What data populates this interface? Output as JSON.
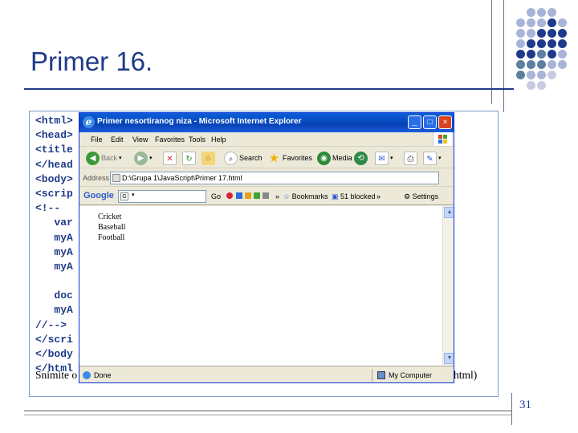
{
  "slide": {
    "title": "Primer  16.",
    "page_number": "31",
    "code_lines": [
      "<html>",
      "<head>",
      "<title",
      "</head",
      "<body>",
      "<scrip",
      "<!--",
      "   var",
      "   myA",
      "   myA",
      "   myA",
      "",
      "   doc",
      "   myA",
      "//-->",
      "</scri",
      "</body",
      "</html"
    ],
    "footer_text": "Snimite o",
    "footer_tail": "html)",
    "colors": {
      "title": "#1f3a8a",
      "code": "#1f3a8a",
      "frame": "#7a9cc6"
    }
  },
  "ie": {
    "title": "Primer nesortiranog niza - Microsoft Internet Explorer",
    "window_buttons": {
      "minimize": "_",
      "maximize": "□",
      "close": "×"
    },
    "menu": [
      "File",
      "Edit",
      "View",
      "Favorites",
      "Tools",
      "Help"
    ],
    "toolbar": {
      "back": "Back",
      "search": "Search",
      "favorites": "Favorites",
      "media": "Media"
    },
    "address": {
      "label": "Address",
      "value": "D:\\Grupa 1\\JavaScript\\Primer 17.html"
    },
    "google": {
      "logo": "Google",
      "go": "Go",
      "more": "»",
      "bookmarks": "Bookmarks",
      "blocked": "51 blocked",
      "more2": "»",
      "settings": "Settings"
    },
    "content_items": [
      "Cricket",
      "Baseball",
      "Football"
    ],
    "status": {
      "left": "Done",
      "right": "My Computer"
    }
  }
}
